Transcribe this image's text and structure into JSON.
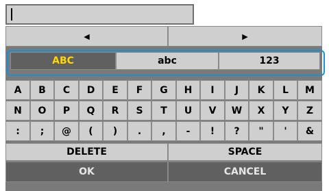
{
  "input": {
    "value": ""
  },
  "nav": {
    "left_arrow": "◀",
    "right_arrow": "▶"
  },
  "modes": [
    {
      "label": "ABC",
      "active": true
    },
    {
      "label": "abc",
      "active": false
    },
    {
      "label": "123",
      "active": false
    }
  ],
  "keys": [
    [
      "A",
      "B",
      "C",
      "D",
      "E",
      "F",
      "G",
      "H",
      "I",
      "J",
      "K",
      "L",
      "M"
    ],
    [
      "N",
      "O",
      "P",
      "Q",
      "R",
      "S",
      "T",
      "U",
      "V",
      "W",
      "X",
      "Y",
      "Z"
    ],
    [
      ":",
      ";",
      "@",
      "(",
      ")",
      ".",
      ",",
      "-",
      "!",
      "?",
      "\"",
      "'",
      "&"
    ]
  ],
  "actions": {
    "delete": "DELETE",
    "space": "SPACE",
    "ok": "OK",
    "cancel": "CANCEL"
  },
  "colors": {
    "highlight": "#ffd700",
    "focus_frame": "#1a8fd4"
  }
}
